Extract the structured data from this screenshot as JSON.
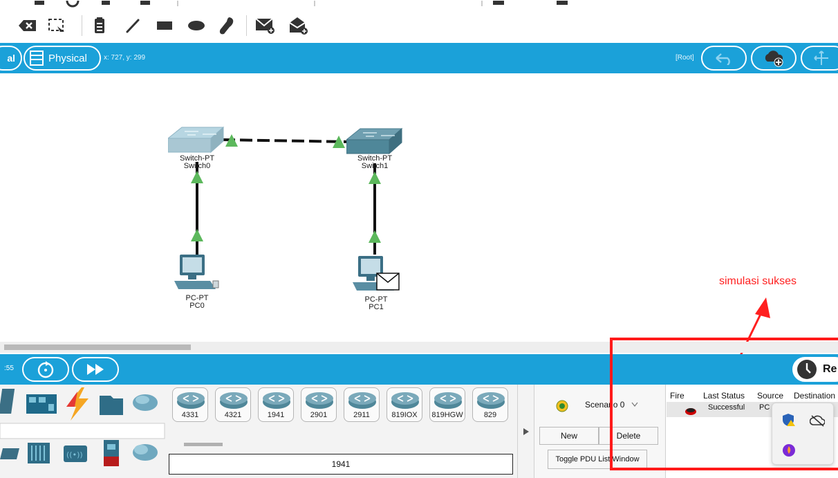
{
  "bluebar": {
    "mode_partial": "al",
    "mode_label": "Physical",
    "coords": "x: 727, y: 299",
    "root_label": "[Root]"
  },
  "toolbar": {
    "icons": [
      "delete-icon",
      "resize-shape-icon",
      "note-icon",
      "line-icon",
      "rectangle-icon",
      "ellipse-icon",
      "freeform-icon",
      "add-simple-pdu-icon",
      "add-complex-pdu-icon"
    ]
  },
  "topology": {
    "devices": [
      {
        "type": "Switch-PT",
        "name": "Switch0"
      },
      {
        "type": "Switch-PT",
        "name": "Switch1"
      },
      {
        "type": "PC-PT",
        "name": "PC0"
      },
      {
        "type": "PC-PT",
        "name": "PC1"
      }
    ],
    "link_status_color": "#5cb85c"
  },
  "sim": {
    "time_partial": ":55"
  },
  "realtime_partial": "Re",
  "routers": [
    "4331",
    "4321",
    "1941",
    "2901",
    "2911",
    "819IOX",
    "819HGW",
    "829"
  ],
  "selected_model": "1941",
  "scenario": {
    "label": "Scenario 0",
    "new_label": "New",
    "delete_label": "Delete",
    "toggle_label": "Toggle PDU List Window"
  },
  "pdu_table": {
    "headers": [
      "Fire",
      "Last Status",
      "Source",
      "Destination"
    ],
    "rows": [
      {
        "fire_color": "#cc0000",
        "status": "Successful",
        "source": "PC"
      }
    ]
  },
  "annotation": {
    "text": "simulasi sukses",
    "color": "#ff1f1f"
  }
}
